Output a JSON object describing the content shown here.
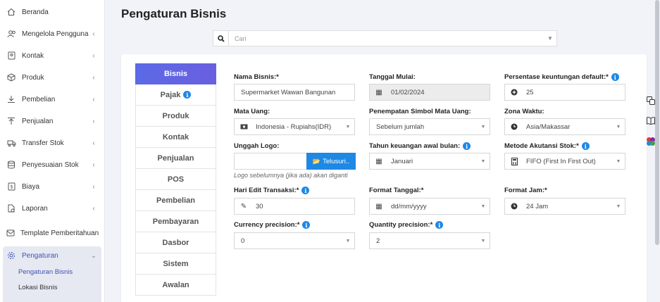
{
  "sidebar": {
    "items": [
      {
        "label": "Beranda",
        "icon": "home-icon",
        "chevron": ""
      },
      {
        "label": "Mengelola Pengguna",
        "icon": "users-icon",
        "chevron": "‹"
      },
      {
        "label": "Kontak",
        "icon": "contact-icon",
        "chevron": "‹"
      },
      {
        "label": "Produk",
        "icon": "cube-icon",
        "chevron": "‹"
      },
      {
        "label": "Pembelian",
        "icon": "purchase-icon",
        "chevron": "‹"
      },
      {
        "label": "Penjualan",
        "icon": "sales-icon",
        "chevron": "‹"
      },
      {
        "label": "Transfer Stok",
        "icon": "truck-icon",
        "chevron": "‹"
      },
      {
        "label": "Penyesuaian Stok",
        "icon": "database-icon",
        "chevron": "‹"
      },
      {
        "label": "Biaya",
        "icon": "expense-icon",
        "chevron": "‹"
      },
      {
        "label": "Laporan",
        "icon": "report-icon",
        "chevron": "‹"
      },
      {
        "label": "Template Pemberitahuan",
        "icon": "envelope-icon",
        "chevron": ""
      },
      {
        "label": "Pengaturan",
        "icon": "gear-icon",
        "chevron": "⌄"
      }
    ],
    "sub_items": [
      {
        "label": "Pengaturan Bisnis"
      },
      {
        "label": "Lokasi Bisnis"
      }
    ]
  },
  "main": {
    "title": "Pengaturan Bisnis",
    "search": {
      "placeholder": "Cari"
    }
  },
  "tabs": [
    {
      "label": "Bisnis",
      "info": false
    },
    {
      "label": "Pajak",
      "info": true
    },
    {
      "label": "Produk",
      "info": false
    },
    {
      "label": "Kontak",
      "info": false
    },
    {
      "label": "Penjualan",
      "info": false
    },
    {
      "label": "POS",
      "info": false
    },
    {
      "label": "Pembelian",
      "info": false
    },
    {
      "label": "Pembayaran",
      "info": false
    },
    {
      "label": "Dasbor",
      "info": false
    },
    {
      "label": "Sistem",
      "info": false
    },
    {
      "label": "Awalan",
      "info": false
    }
  ],
  "form": {
    "business_name": {
      "label": "Nama Bisnis:*",
      "value": "Supermarket Wawan Bangunan"
    },
    "start_date": {
      "label": "Tanggal Mulai:",
      "value": "01/02/2024"
    },
    "profit_percent": {
      "label": "Persentase keuntungan default:*",
      "value": "25"
    },
    "currency": {
      "label": "Mata Uang:",
      "value": "Indonesia - Rupiahs(IDR)"
    },
    "symbol_placement": {
      "label": "Penempatan Simbol Mata Uang:",
      "value": "Sebelum jumlah"
    },
    "timezone": {
      "label": "Zona Waktu:",
      "value": "Asia/Makassar"
    },
    "logo": {
      "label": "Unggah Logo:",
      "button": "Telusuri..",
      "helper": "Logo sebelumnya (jika ada) akan diganti"
    },
    "fy_start": {
      "label": "Tahun keuangan awal bulan:",
      "value": "Januari"
    },
    "accounting_method": {
      "label": "Metode Akutansi Stok:*",
      "value": "FIFO (First In First Out)"
    },
    "edit_days": {
      "label": "Hari Edit Transaksi:*",
      "value": "30"
    },
    "date_format": {
      "label": "Format Tanggal:*",
      "value": "dd/mm/yyyy"
    },
    "time_format": {
      "label": "Format Jam:*",
      "value": "24 Jam"
    },
    "currency_precision": {
      "label": "Currency precision:*",
      "value": "0"
    },
    "quantity_precision": {
      "label": "Quantity precision:*",
      "value": "2"
    }
  },
  "colors": {
    "accent": "#5b6ae6",
    "info": "#1e88e5",
    "active_nav": "#3f51b5"
  }
}
